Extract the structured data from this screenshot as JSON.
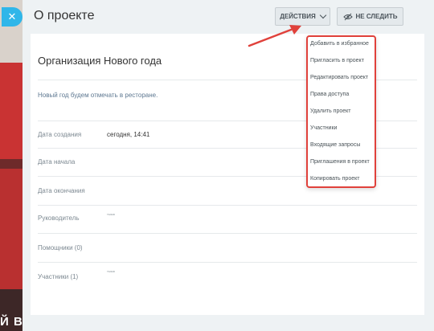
{
  "header": {
    "title": "О проекте",
    "actions_label": "Действия",
    "follow_label": "Не следить",
    "close_glyph": "✕"
  },
  "background": {
    "partial_text": "Й В"
  },
  "project": {
    "name": "Организация Нового года",
    "description": "Новый год будем отмечать в ресторане."
  },
  "details": [
    {
      "label": "Дата создания",
      "value": "сегодня, 14:41"
    },
    {
      "label": "Дата начала",
      "value": ""
    },
    {
      "label": "Дата окончания",
      "value": ""
    },
    {
      "label": "Руководитель",
      "value": ""
    },
    {
      "label": "Помощники (0)",
      "value": ""
    },
    {
      "label": "Участники (1)",
      "value": ""
    }
  ],
  "person_tiny": "тыыя",
  "actions_menu": [
    "Добавить в избранное",
    "Пригласить в проект",
    "Редактировать проект",
    "Права доступа",
    "Удалить проект",
    "Участники",
    "Входящие запросы",
    "Приглашения в проект",
    "Копировать проект"
  ],
  "colors": {
    "accent_blue": "#2fb6e9",
    "highlight_red": "#e0413b",
    "description_text": "#5e7891"
  }
}
